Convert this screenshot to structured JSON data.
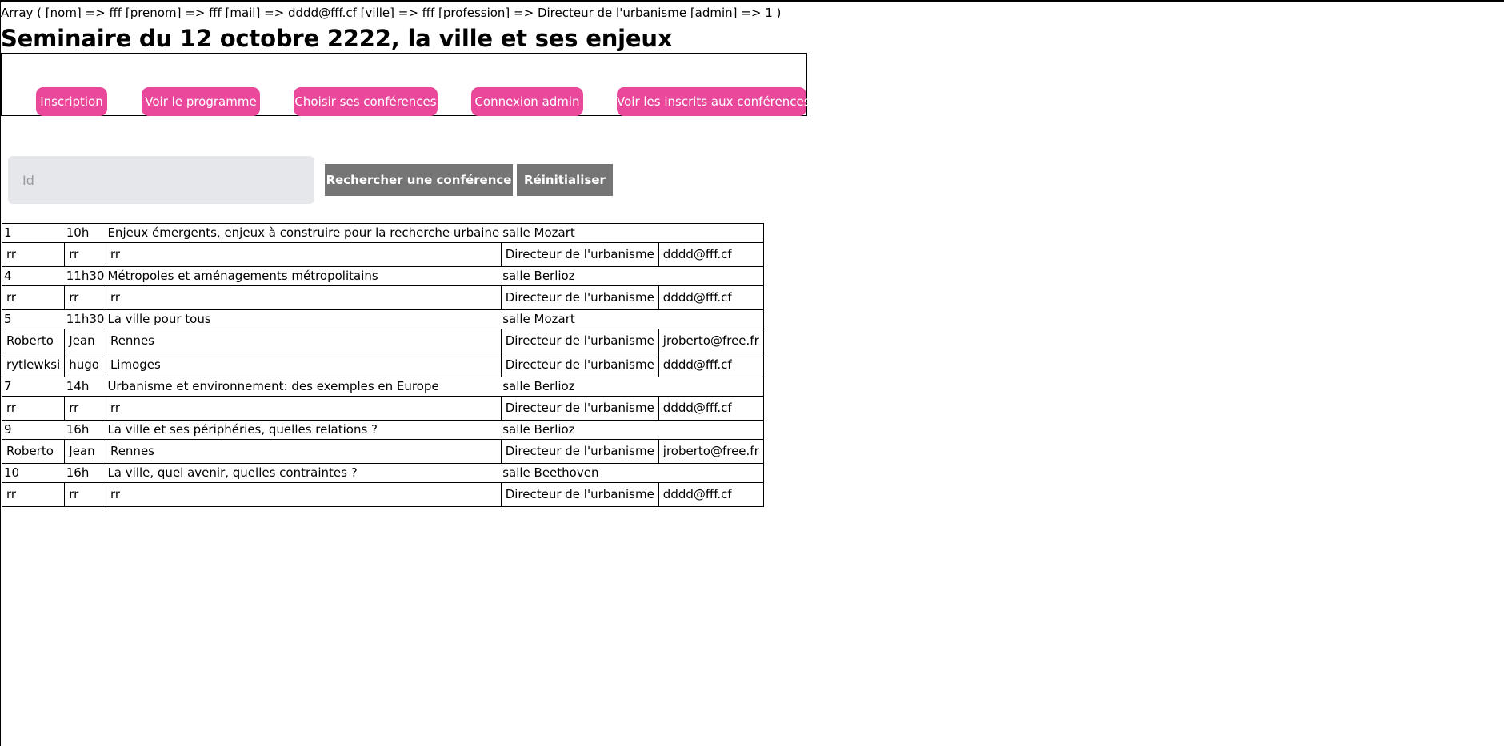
{
  "debug_text": "Array ( [nom] => fff [prenom] => fff [mail] => dddd@fff.cf [ville] => fff [profession] => Directeur de l'urbanisme [admin] => 1 )",
  "page_title": "Seminaire du 12 octobre 2222, la ville et ses enjeux",
  "nav": {
    "inscription": "Inscription",
    "programme": "Voir le programme",
    "choisir": "Choisir ses conférences",
    "admin": "Connexion admin",
    "inscrits": "Voir les inscrits aux conférences"
  },
  "search": {
    "placeholder": "Id",
    "value": "",
    "search_label": "Rechercher une conférence",
    "reset_label": "Réinitialiser"
  },
  "colors": {
    "nav_button": "#e9489b",
    "action_button": "#757575",
    "input_bg": "#e6e7ea"
  },
  "conferences": [
    {
      "id": "1",
      "time": "10h",
      "title": "Enjeux émergents, enjeux à construire pour la recherche urbaine",
      "room": "salle Mozart",
      "participants": [
        {
          "nom": "rr",
          "prenom": "rr",
          "ville": "rr",
          "profession": "Directeur de l'urbanisme",
          "mail": "dddd@fff.cf"
        }
      ]
    },
    {
      "id": "4",
      "time": "11h30",
      "title": "Métropoles et aménagements métropolitains",
      "room": "salle Berlioz",
      "participants": [
        {
          "nom": "rr",
          "prenom": "rr",
          "ville": "rr",
          "profession": "Directeur de l'urbanisme",
          "mail": "dddd@fff.cf"
        }
      ]
    },
    {
      "id": "5",
      "time": "11h30",
      "title": "La ville pour tous",
      "room": "salle Mozart",
      "participants": [
        {
          "nom": "Roberto",
          "prenom": "Jean",
          "ville": "Rennes",
          "profession": "Directeur de l'urbanisme",
          "mail": "jroberto@free.fr"
        },
        {
          "nom": "rytlewksi",
          "prenom": "hugo",
          "ville": "Limoges",
          "profession": "Directeur de l'urbanisme",
          "mail": "dddd@fff.cf"
        }
      ]
    },
    {
      "id": "7",
      "time": "14h",
      "title": "Urbanisme et environnement: des exemples en Europe",
      "room": "salle Berlioz",
      "participants": [
        {
          "nom": "rr",
          "prenom": "rr",
          "ville": "rr",
          "profession": "Directeur de l'urbanisme",
          "mail": "dddd@fff.cf"
        }
      ]
    },
    {
      "id": "9",
      "time": "16h",
      "title": "La ville et ses périphéries, quelles relations ?",
      "room": "salle Berlioz",
      "participants": [
        {
          "nom": "Roberto",
          "prenom": "Jean",
          "ville": "Rennes",
          "profession": "Directeur de l'urbanisme",
          "mail": "jroberto@free.fr"
        }
      ]
    },
    {
      "id": "10",
      "time": "16h",
      "title": "La ville, quel avenir, quelles contraintes ?",
      "room": "salle Beethoven",
      "participants": [
        {
          "nom": "rr",
          "prenom": "rr",
          "ville": "rr",
          "profession": "Directeur de l'urbanisme",
          "mail": "dddd@fff.cf"
        }
      ]
    }
  ]
}
